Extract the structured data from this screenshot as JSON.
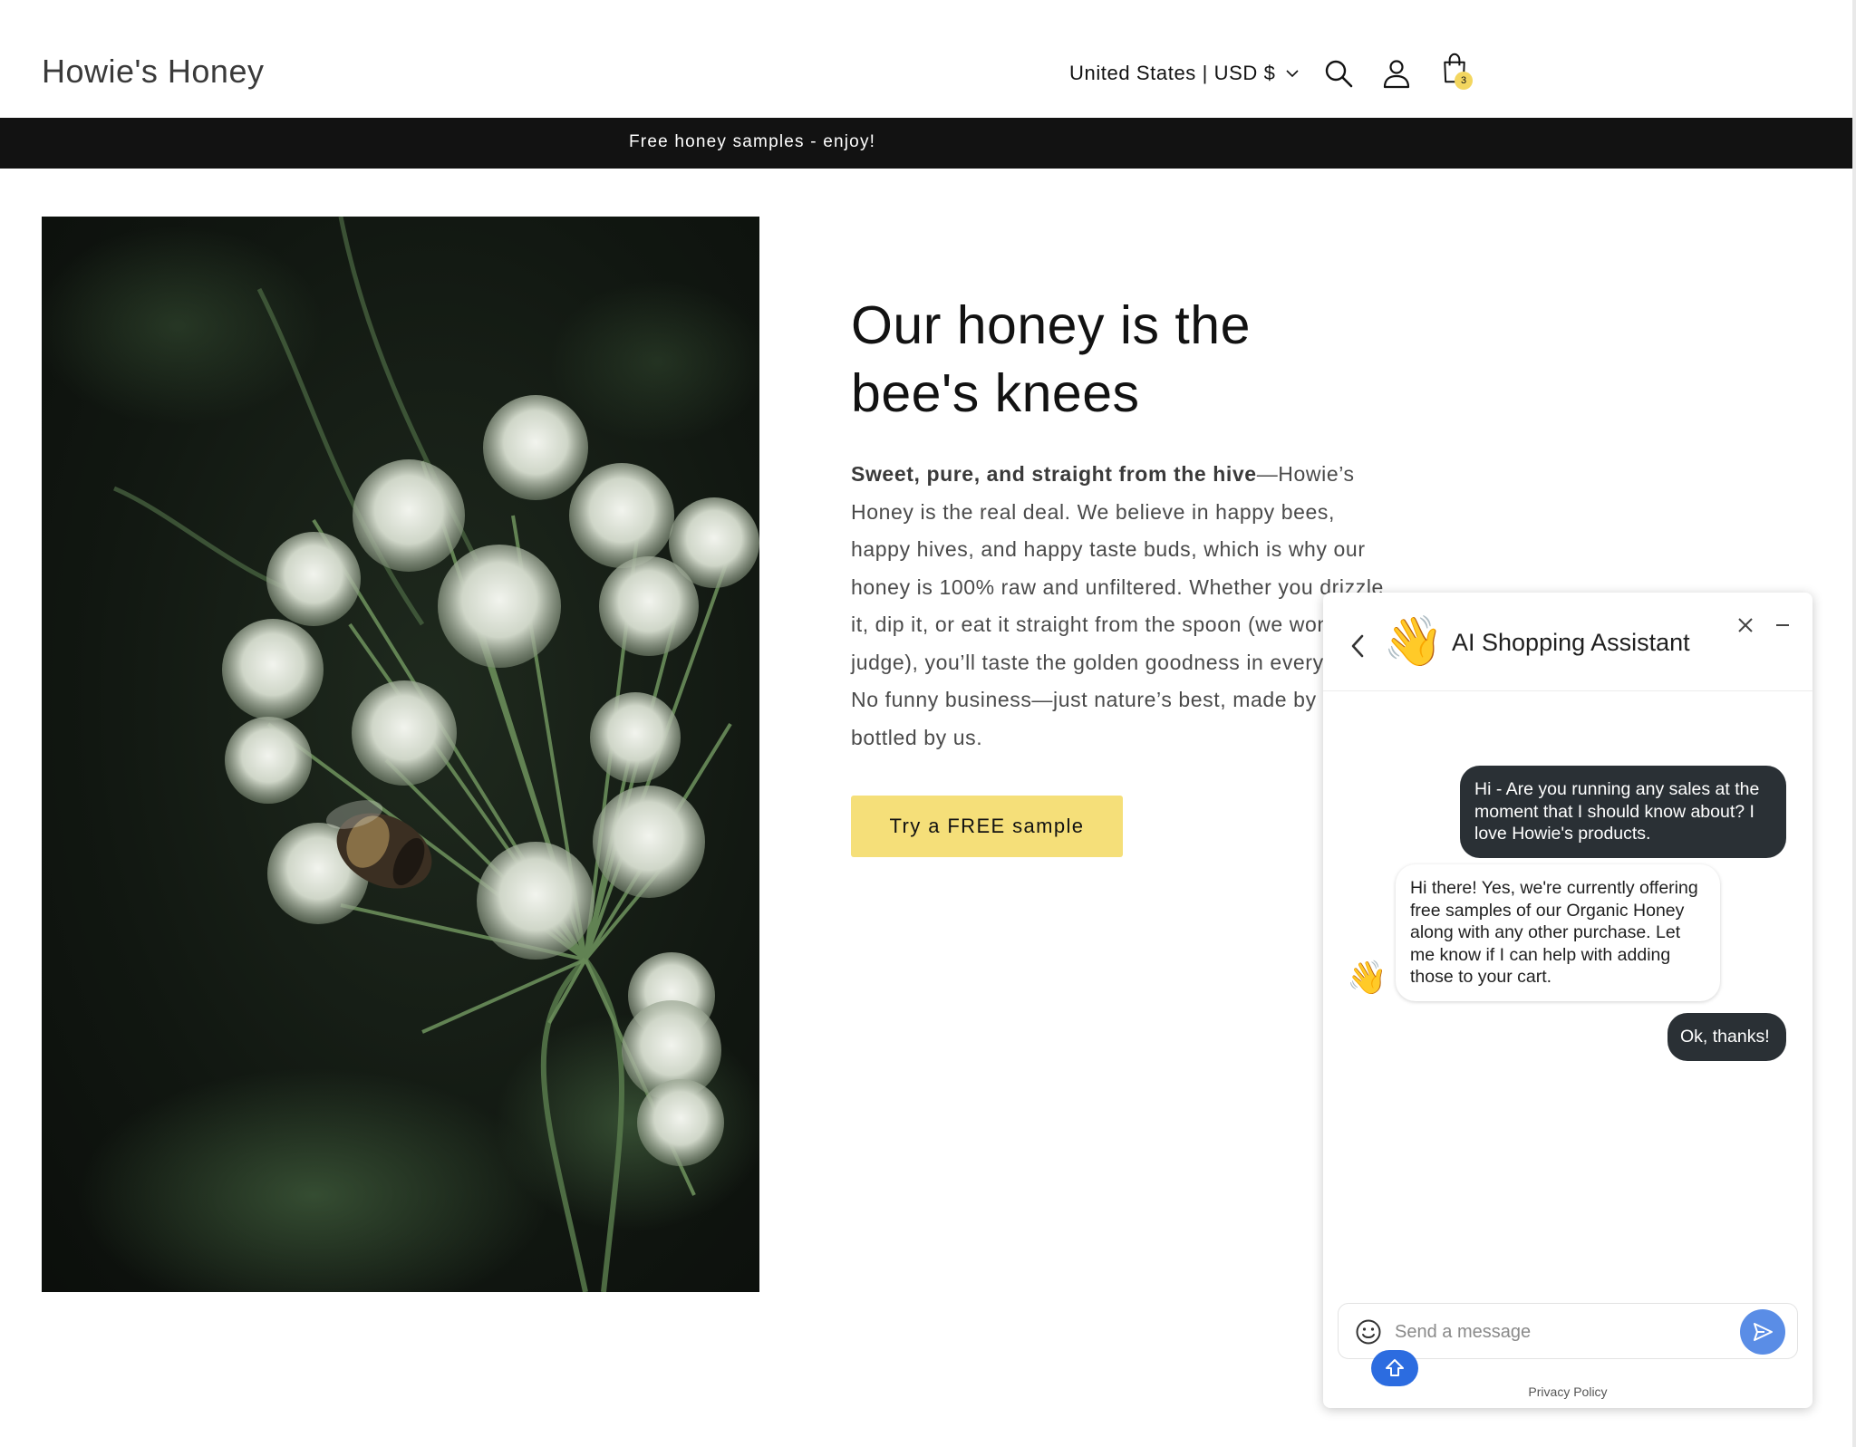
{
  "header": {
    "brand": "Howie's Honey",
    "locale_label": "United States | USD $",
    "icons": [
      "search-icon",
      "account-icon",
      "cart-icon"
    ],
    "cart_count": "3"
  },
  "announcement": {
    "text": "Free honey samples - enjoy!"
  },
  "hero": {
    "title_line1": "Our honey is the",
    "title_line2": "bee's knees",
    "body_bold": "Sweet, pure, and straight from the hive",
    "body_rest": "—Howie’s Honey is the real deal. We believe in happy bees, happy hives, and happy taste buds, which is why our honey is 100% raw and unfiltered. Whether you drizzle it, dip it, or eat it straight from the spoon (we won’t judge), you’ll taste the golden goodness in every drop. No funny business—just nature’s best, made by bees, bottled by us.",
    "cta_label": "Try a FREE sample"
  },
  "chat": {
    "title": "AI Shopping Assistant",
    "header_emoji": "👋",
    "messages": [
      {
        "from": "user",
        "text": "Hi - Are you running any sales at the moment that I should know about? I love Howie's products."
      },
      {
        "from": "bot",
        "text": "Hi there! Yes, we're currently offering free samples of our Organic Honey along with any other purchase. Let me know if I can help with adding those to your cart."
      },
      {
        "from": "user",
        "text": "Ok, thanks!"
      }
    ],
    "bot_avatar_emoji": "👋",
    "input_placeholder": "Send a message",
    "input_value": "",
    "privacy_label": "Privacy Policy"
  },
  "colors": {
    "announcement_bg": "#121212",
    "cta_bg": "#f5df79",
    "cart_badge": "#f3d65f",
    "user_bubble": "#2a3035",
    "send_button": "#5a8de6",
    "upload_button": "#2c6ce0"
  }
}
